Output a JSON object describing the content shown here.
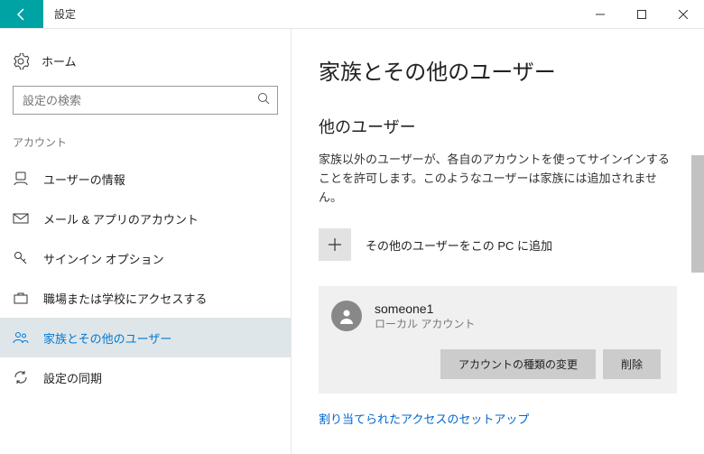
{
  "window": {
    "title": "設定"
  },
  "sidebar": {
    "home": "ホーム",
    "search_placeholder": "設定の検索",
    "section": "アカウント",
    "items": [
      {
        "label": "ユーザーの情報"
      },
      {
        "label": "メール & アプリのアカウント"
      },
      {
        "label": "サインイン オプション"
      },
      {
        "label": "職場または学校にアクセスする"
      },
      {
        "label": "家族とその他のユーザー"
      },
      {
        "label": "設定の同期"
      }
    ]
  },
  "main": {
    "title": "家族とその他のユーザー",
    "section_title": "他のユーザー",
    "section_desc": "家族以外のユーザーが、各自のアカウントを使ってサインインすることを許可します。このようなユーザーは家族には追加されません。",
    "add_label": "その他のユーザーをこの PC に追加",
    "user": {
      "name": "someone1",
      "type": "ローカル アカウント"
    },
    "btn_change": "アカウントの種類の変更",
    "btn_remove": "削除",
    "link": "割り当てられたアクセスのセットアップ"
  }
}
